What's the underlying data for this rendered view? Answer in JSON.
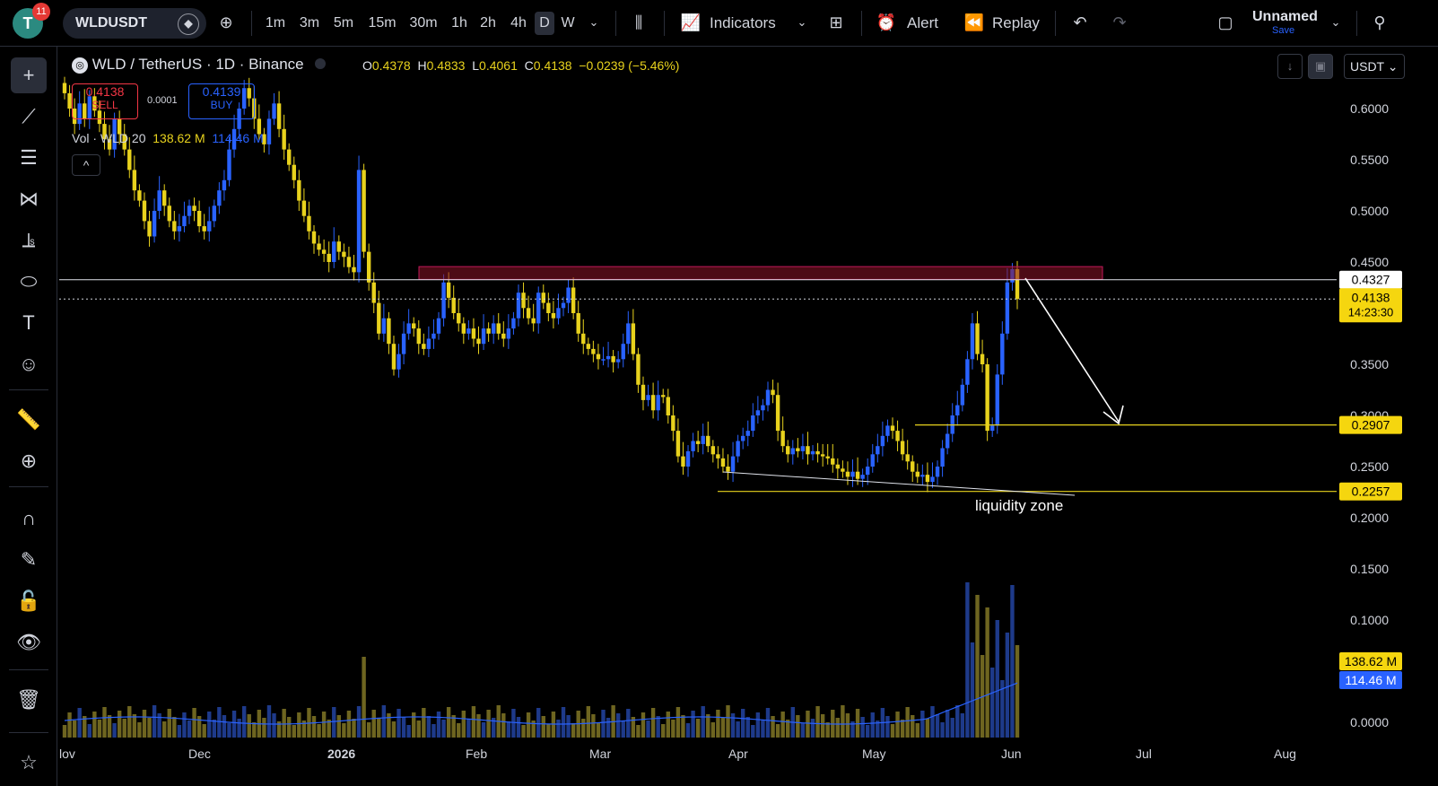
{
  "toolbar": {
    "notifications": "11",
    "avatar_letter": "T",
    "symbol": "WLDUSDT",
    "timeframes": [
      "1m",
      "3m",
      "5m",
      "15m",
      "30m",
      "1h",
      "2h",
      "4h",
      "D",
      "W"
    ],
    "active_timeframe": "D",
    "indicators_label": "Indicators",
    "alert_label": "Alert",
    "replay_label": "Replay",
    "layout_name": "Unnamed",
    "save_label": "Save"
  },
  "legend": {
    "title": "WLD / TetherUS · 1D · Binance",
    "open_label": "O",
    "open": "0.4378",
    "high_label": "H",
    "high": "0.4833",
    "low_label": "L",
    "low": "0.4061",
    "close_label": "C",
    "close": "0.4138",
    "change": "−0.0239 (−5.46%)",
    "sell_price": "0.4138",
    "sell_label": "SELL",
    "spread": "0.0001",
    "buy_price": "0.4139",
    "buy_label": "BUY",
    "vol_label": "Vol · WLD 20",
    "vol_value1": "138.62 M",
    "vol_value2": "114.46 M",
    "currency": "USDT"
  },
  "chart_data": {
    "type": "candlestick",
    "x_ticks": [
      "lov",
      "Dec",
      "2026",
      "Feb",
      "Mar",
      "Apr",
      "May",
      "Jun",
      "Jul",
      "Aug"
    ],
    "y_ticks": [
      "0.6000",
      "0.5500",
      "0.5000",
      "0.4500",
      "0.3500",
      "0.3000",
      "0.2500",
      "0.2000",
      "0.1500",
      "0.1000",
      "0.0000"
    ],
    "ylim": [
      0.0,
      0.64
    ],
    "price_labels": {
      "resistance": "0.4327",
      "last_price": "0.4138",
      "countdown": "14:23:30",
      "target": "0.2907",
      "liquidity": "0.2257",
      "vol1": "138.62 M",
      "vol2": "114.46 M"
    },
    "levels": {
      "resistance": 0.4327,
      "last": 0.4138,
      "target": 0.2907,
      "liquidity": 0.2257
    },
    "zone": {
      "from": 0.433,
      "to": 0.4455
    },
    "annotation": "liquidity zone",
    "closes": [
      0.615,
      0.6,
      0.585,
      0.605,
      0.59,
      0.612,
      0.598,
      0.585,
      0.57,
      0.56,
      0.59,
      0.575,
      0.56,
      0.54,
      0.52,
      0.51,
      0.49,
      0.475,
      0.5,
      0.52,
      0.505,
      0.49,
      0.48,
      0.485,
      0.495,
      0.505,
      0.5,
      0.485,
      0.48,
      0.49,
      0.505,
      0.52,
      0.53,
      0.56,
      0.58,
      0.6,
      0.62,
      0.61,
      0.59,
      0.575,
      0.565,
      0.59,
      0.605,
      0.58,
      0.56,
      0.545,
      0.53,
      0.51,
      0.495,
      0.48,
      0.468,
      0.462,
      0.458,
      0.45,
      0.47,
      0.46,
      0.455,
      0.445,
      0.44,
      0.54,
      0.46,
      0.43,
      0.41,
      0.38,
      0.395,
      0.37,
      0.345,
      0.36,
      0.38,
      0.39,
      0.385,
      0.37,
      0.365,
      0.375,
      0.38,
      0.395,
      0.43,
      0.415,
      0.4,
      0.39,
      0.38,
      0.385,
      0.375,
      0.37,
      0.385,
      0.38,
      0.39,
      0.38,
      0.375,
      0.385,
      0.395,
      0.42,
      0.405,
      0.395,
      0.39,
      0.42,
      0.41,
      0.4,
      0.395,
      0.405,
      0.41,
      0.425,
      0.4,
      0.38,
      0.37,
      0.365,
      0.36,
      0.355,
      0.355,
      0.358,
      0.352,
      0.355,
      0.37,
      0.39,
      0.36,
      0.33,
      0.315,
      0.32,
      0.305,
      0.32,
      0.318,
      0.3,
      0.285,
      0.26,
      0.25,
      0.265,
      0.275,
      0.272,
      0.28,
      0.27,
      0.262,
      0.258,
      0.25,
      0.245,
      0.26,
      0.275,
      0.28,
      0.285,
      0.3,
      0.305,
      0.31,
      0.325,
      0.32,
      0.285,
      0.27,
      0.262,
      0.268,
      0.265,
      0.27,
      0.262,
      0.265,
      0.262,
      0.26,
      0.258,
      0.252,
      0.248,
      0.245,
      0.24,
      0.245,
      0.238,
      0.242,
      0.25,
      0.262,
      0.27,
      0.28,
      0.29,
      0.285,
      0.275,
      0.262,
      0.255,
      0.245,
      0.24,
      0.242,
      0.235,
      0.24,
      0.25,
      0.268,
      0.282,
      0.3,
      0.31,
      0.33,
      0.355,
      0.39,
      0.36,
      0.35,
      0.285,
      0.29,
      0.34,
      0.38,
      0.43,
      0.443,
      0.4138
    ]
  }
}
